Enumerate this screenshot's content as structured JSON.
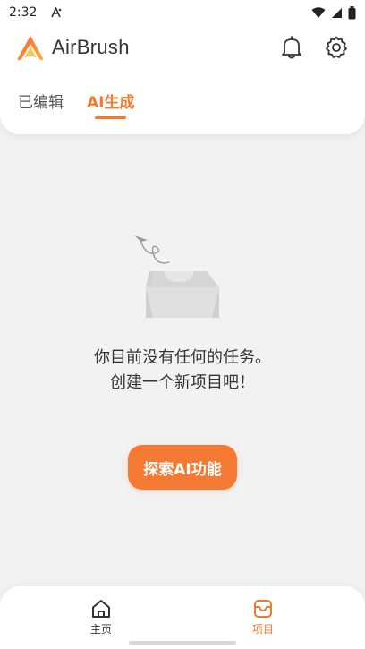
{
  "status_bar": {
    "time": "2:32"
  },
  "app": {
    "name": "AirBrush"
  },
  "tabs": [
    {
      "label": "已编辑",
      "active": false
    },
    {
      "label": "AI生成",
      "active": true
    }
  ],
  "empty_state": {
    "line1": "你目前没有任何的任务。",
    "line2": "创建一个新项目吧！",
    "cta_label": "探索AI功能"
  },
  "bottom_nav": [
    {
      "label": "主页",
      "icon": "home-icon",
      "active": false
    },
    {
      "label": "项目",
      "icon": "projects-icon",
      "active": true
    }
  ],
  "colors": {
    "accent": "#f07a2e",
    "button": "#f47a34",
    "background": "#f2f2f2"
  }
}
